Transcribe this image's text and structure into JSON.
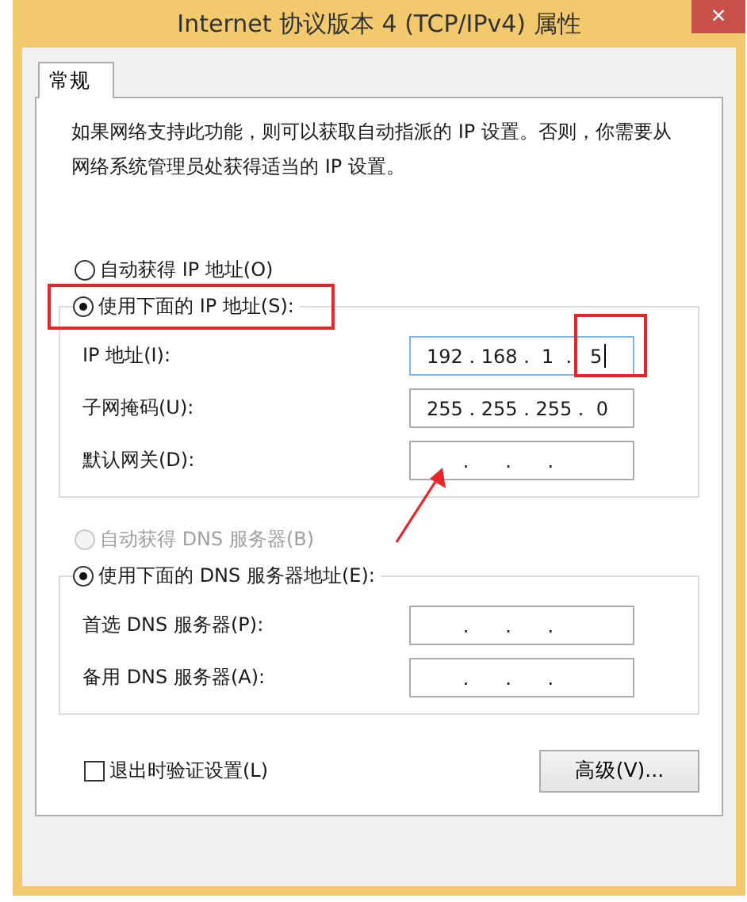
{
  "window": {
    "title": "Internet 协议版本 4 (TCP/IPv4) 属性",
    "close": "×"
  },
  "tabs": [
    {
      "label": "常规",
      "selected": true
    }
  ],
  "description": "如果网络支持此功能，则可以获取自动指派的 IP 设置。否则，你需要从网络系统管理员处获得适当的 IP 设置。",
  "ip_section": {
    "auto_option": {
      "label": "自动获得 IP 地址(O)",
      "selected": false,
      "disabled": false
    },
    "manual_option": {
      "label": "使用下面的 IP 地址(S):",
      "selected": true,
      "disabled": false
    },
    "fields": [
      {
        "label": "IP 地址(I):",
        "value": "192 . 168 .  1  .   5",
        "focused": true
      },
      {
        "label": "子网掩码(U):",
        "value": "255 . 255 . 255 .  0",
        "focused": false
      },
      {
        "label": "默认网关(D):",
        "value": "      .      .      .",
        "focused": false
      }
    ]
  },
  "dns_section": {
    "auto_option": {
      "label": "自动获得 DNS 服务器(B)",
      "selected": false,
      "disabled": true
    },
    "manual_option": {
      "label": "使用下面的 DNS 服务器地址(E):",
      "selected": true,
      "disabled": false
    },
    "fields": [
      {
        "label": "首选 DNS 服务器(P):",
        "value": "      .      .      .",
        "focused": false
      },
      {
        "label": "备用 DNS 服务器(A):",
        "value": "      .      .      .",
        "focused": false
      }
    ]
  },
  "validate_checkbox": {
    "label": "退出时验证设置(L)",
    "checked": false
  },
  "advanced_button": "高级(V)..."
}
